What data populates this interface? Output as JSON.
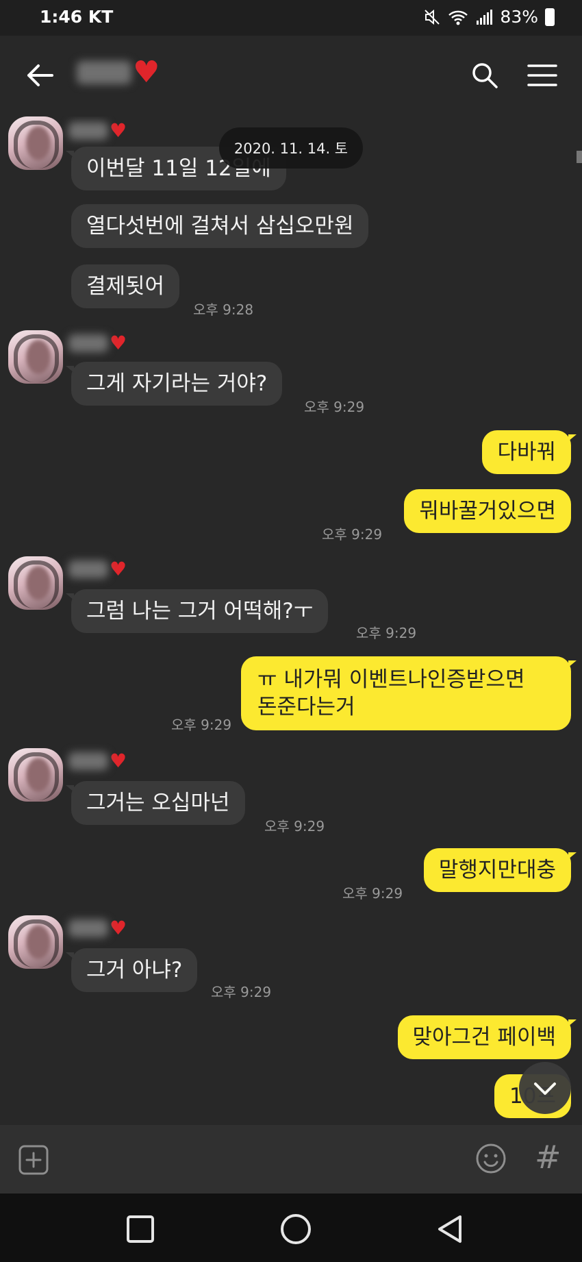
{
  "status_bar": {
    "time": "1:46",
    "carrier": "KT",
    "battery": "83%"
  },
  "header": {
    "title_heart": "♥"
  },
  "date_divider": "2020. 11. 14. 토",
  "senders": [
    {
      "heart": "♥"
    },
    {
      "heart": "♥"
    },
    {
      "heart": "♥"
    },
    {
      "heart": "♥"
    },
    {
      "heart": "♥"
    }
  ],
  "messages": [
    {
      "side": "in",
      "text": "이번달 11일 12일에"
    },
    {
      "side": "in",
      "text": "열다섯번에 걸쳐서 삼십오만원"
    },
    {
      "side": "in",
      "text": "결제됫어",
      "time": "오후 9:28"
    },
    {
      "side": "in",
      "text": "그게 자기라는 거야?",
      "time": "오후 9:29"
    },
    {
      "side": "out",
      "text": "다바꿔"
    },
    {
      "side": "out",
      "text": "뭐바꿀거있으면",
      "time": "오후 9:29"
    },
    {
      "side": "in",
      "text": "그럼 나는 그거 어떡해?ㅜ",
      "time": "오후 9:29"
    },
    {
      "side": "out",
      "line1": "ㅠ 내가뭐 이벤트나인증받으면",
      "line2": "돈준다는거",
      "time": "오후 9:29"
    },
    {
      "side": "in",
      "text": "그거는 오십마넌",
      "time": "오후 9:29"
    },
    {
      "side": "out",
      "text": "말행지만대충",
      "time": "오후 9:29"
    },
    {
      "side": "in",
      "text": "그거 아냐?",
      "time": "오후 9:29"
    },
    {
      "side": "out",
      "text": "맞아그건 페이백"
    },
    {
      "side": "out",
      "text": "10프"
    }
  ],
  "input_bar": {
    "hash": "#"
  },
  "icons": [
    "back-arrow-icon",
    "search-icon",
    "menu-icon",
    "heart-icon",
    "plus-icon",
    "emoji-icon",
    "hash-icon",
    "chevron-down-icon",
    "mute-icon",
    "wifi-icon",
    "signal-icon",
    "battery-icon"
  ],
  "colors": {
    "incoming_bubble": "#3a3a3a",
    "outgoing_bubble": "#fce930",
    "background": "#282828"
  }
}
